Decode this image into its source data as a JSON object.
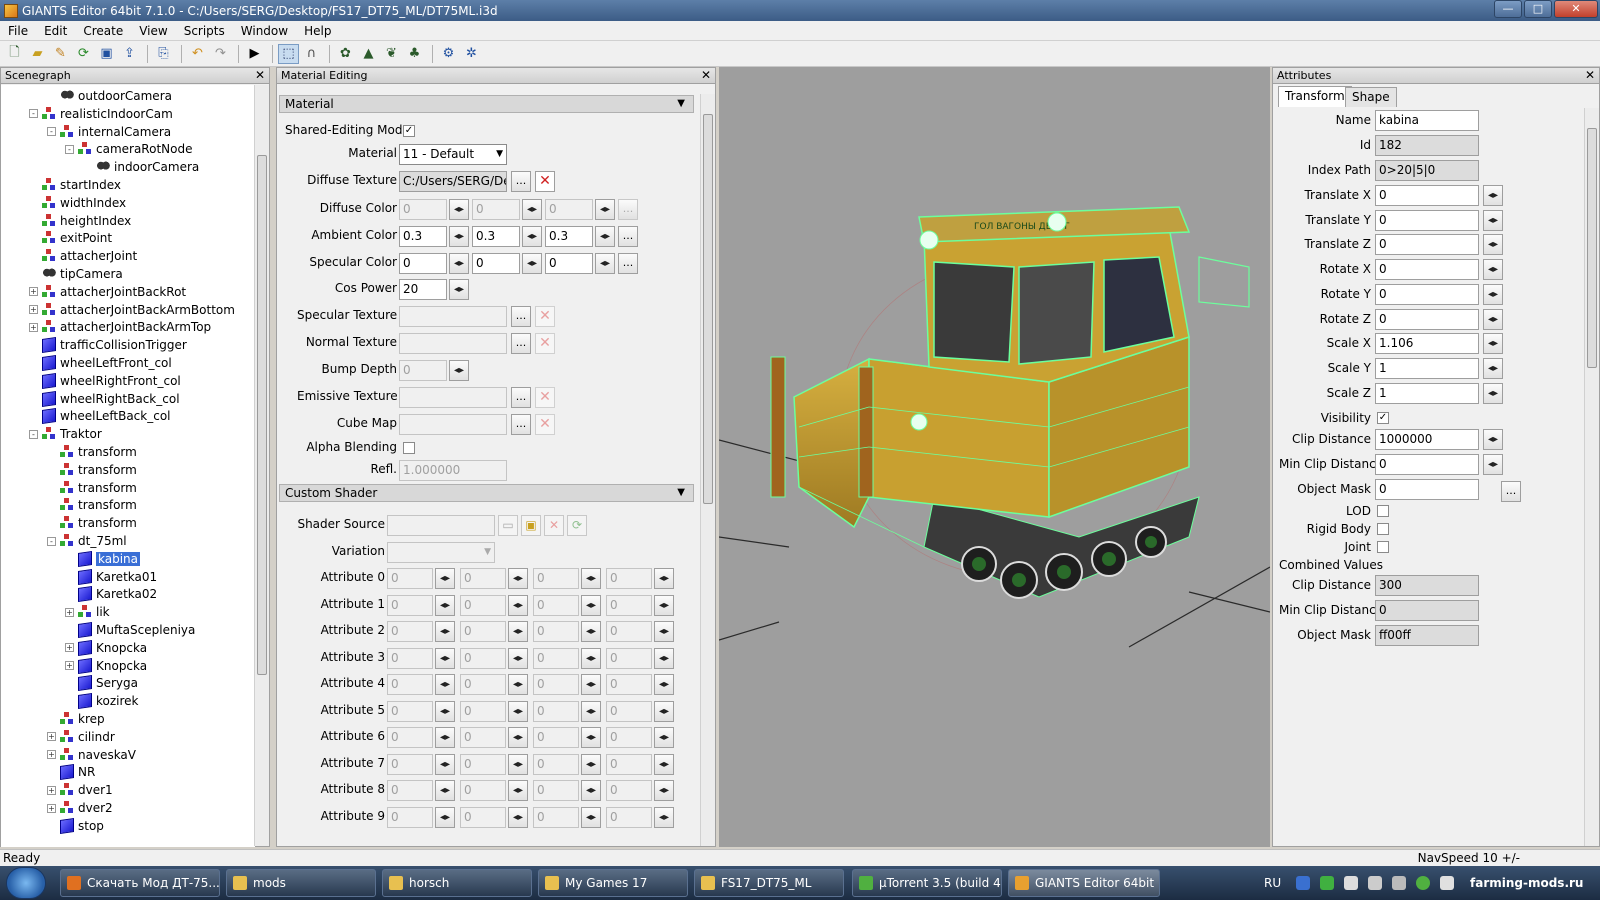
{
  "window": {
    "title": "GIANTS Editor 64bit 7.1.0 - C:/Users/SERG/Desktop/FS17_DT75_ML/DT75ML.i3d",
    "minimize": "—",
    "maximize": "□",
    "close": "✕"
  },
  "menu": [
    "File",
    "Edit",
    "Create",
    "View",
    "Scripts",
    "Window",
    "Help"
  ],
  "toolbar_icons": [
    "new-icon",
    "open-icon",
    "edit-icon",
    "refresh-icon",
    "save-icon",
    "export-icon",
    "import-icon",
    "undo-icon",
    "redo-icon",
    "play-icon",
    "select-icon",
    "magnet-icon",
    "paint-icon",
    "terrain-icon",
    "foliage-icon",
    "tree-icon",
    "sync-icon",
    "settings-icon"
  ],
  "scenegraph": {
    "title": "Scenegraph",
    "close": "✕",
    "items": [
      {
        "label": "outdoorCamera",
        "depth": 2,
        "icon": "camera",
        "exp": ""
      },
      {
        "label": "realisticIndoorCam",
        "depth": 1,
        "icon": "tg",
        "exp": "-"
      },
      {
        "label": "internalCamera",
        "depth": 2,
        "icon": "tg",
        "exp": "-"
      },
      {
        "label": "cameraRotNode",
        "depth": 3,
        "icon": "tg",
        "exp": "-"
      },
      {
        "label": "indoorCamera",
        "depth": 4,
        "icon": "camera",
        "exp": ""
      },
      {
        "label": "startIndex",
        "depth": 1,
        "icon": "tg",
        "exp": ""
      },
      {
        "label": "widthIndex",
        "depth": 1,
        "icon": "tg",
        "exp": ""
      },
      {
        "label": "heightIndex",
        "depth": 1,
        "icon": "tg",
        "exp": ""
      },
      {
        "label": "exitPoint",
        "depth": 1,
        "icon": "tg",
        "exp": ""
      },
      {
        "label": "attacherJoint",
        "depth": 1,
        "icon": "tg",
        "exp": ""
      },
      {
        "label": "tipCamera",
        "depth": 1,
        "icon": "camera",
        "exp": ""
      },
      {
        "label": "attacherJointBackRot",
        "depth": 1,
        "icon": "tg",
        "exp": "+"
      },
      {
        "label": "attacherJointBackArmBottom",
        "depth": 1,
        "icon": "tg",
        "exp": "+"
      },
      {
        "label": "attacherJointBackArmTop",
        "depth": 1,
        "icon": "tg",
        "exp": "+"
      },
      {
        "label": "trafficCollisionTrigger",
        "depth": 1,
        "icon": "cube",
        "exp": ""
      },
      {
        "label": "wheelLeftFront_col",
        "depth": 1,
        "icon": "cube",
        "exp": ""
      },
      {
        "label": "wheelRightFront_col",
        "depth": 1,
        "icon": "cube",
        "exp": ""
      },
      {
        "label": "wheelRightBack_col",
        "depth": 1,
        "icon": "cube",
        "exp": ""
      },
      {
        "label": "wheelLeftBack_col",
        "depth": 1,
        "icon": "cube",
        "exp": ""
      },
      {
        "label": "Traktor",
        "depth": 1,
        "icon": "tg",
        "exp": "-"
      },
      {
        "label": "transform",
        "depth": 2,
        "icon": "tg",
        "exp": ""
      },
      {
        "label": "transform",
        "depth": 2,
        "icon": "tg",
        "exp": ""
      },
      {
        "label": "transform",
        "depth": 2,
        "icon": "tg",
        "exp": ""
      },
      {
        "label": "transform",
        "depth": 2,
        "icon": "tg",
        "exp": ""
      },
      {
        "label": "transform",
        "depth": 2,
        "icon": "tg",
        "exp": ""
      },
      {
        "label": "dt_75ml",
        "depth": 2,
        "icon": "tg",
        "exp": "-"
      },
      {
        "label": "kabina",
        "depth": 3,
        "icon": "cube",
        "exp": "",
        "selected": true
      },
      {
        "label": "Karetka01",
        "depth": 3,
        "icon": "cube",
        "exp": ""
      },
      {
        "label": "Karetka02",
        "depth": 3,
        "icon": "cube",
        "exp": ""
      },
      {
        "label": "lik",
        "depth": 3,
        "icon": "tg",
        "exp": "+"
      },
      {
        "label": "MuftaScepleniya",
        "depth": 3,
        "icon": "cube",
        "exp": ""
      },
      {
        "label": "Knopcka",
        "depth": 3,
        "icon": "cube",
        "exp": "+"
      },
      {
        "label": "Knopcka",
        "depth": 3,
        "icon": "cube",
        "exp": "+"
      },
      {
        "label": "Seryga",
        "depth": 3,
        "icon": "cube",
        "exp": ""
      },
      {
        "label": "kozirek",
        "depth": 3,
        "icon": "cube",
        "exp": ""
      },
      {
        "label": "krep",
        "depth": 2,
        "icon": "tg",
        "exp": ""
      },
      {
        "label": "cilindr",
        "depth": 2,
        "icon": "tg",
        "exp": "+"
      },
      {
        "label": "naveskaV",
        "depth": 2,
        "icon": "tg",
        "exp": "+"
      },
      {
        "label": "NR",
        "depth": 2,
        "icon": "cube",
        "exp": ""
      },
      {
        "label": "dver1",
        "depth": 2,
        "icon": "tg",
        "exp": "+"
      },
      {
        "label": "dver2",
        "depth": 2,
        "icon": "tg",
        "exp": "+"
      },
      {
        "label": "stop",
        "depth": 2,
        "icon": "cube",
        "exp": ""
      }
    ]
  },
  "material": {
    "panel_title": "Material Editing",
    "close": "✕",
    "section_material": "Material",
    "shared_mode_label": "Shared-Editing Mode",
    "shared_mode_checked": "✓",
    "material_label": "Material",
    "material_value": "11 - Default",
    "diffuse_texture_label": "Diffuse Texture",
    "diffuse_texture_value": "C:/Users/SERG/Des",
    "dots": "...",
    "redx": "✕",
    "spin": "◂▸",
    "diffuse_color_label": "Diffuse Color",
    "diffuse_color": [
      "0",
      "0",
      "0"
    ],
    "ambient_color_label": "Ambient Color",
    "ambient_color": [
      "0.3",
      "0.3",
      "0.3"
    ],
    "specular_color_label": "Specular Color",
    "specular_color": [
      "0",
      "0",
      "0"
    ],
    "cos_power_label": "Cos Power",
    "cos_power": "20",
    "specular_texture_label": "Specular Texture",
    "normal_texture_label": "Normal Texture",
    "bump_depth_label": "Bump Depth",
    "bump_depth": "0",
    "emissive_texture_label": "Emissive Texture",
    "cube_map_label": "Cube Map",
    "alpha_blending_label": "Alpha Blending",
    "refl_label": "Refl.",
    "refl_value": "1.000000",
    "section_shader": "Custom Shader",
    "shader_source_label": "Shader Source",
    "variation_label": "Variation",
    "attributes": [
      {
        "label": "Attribute 0",
        "values": [
          "0",
          "0",
          "0",
          "0"
        ]
      },
      {
        "label": "Attribute 1",
        "values": [
          "0",
          "0",
          "0",
          "0"
        ]
      },
      {
        "label": "Attribute 2",
        "values": [
          "0",
          "0",
          "0",
          "0"
        ]
      },
      {
        "label": "Attribute 3",
        "values": [
          "0",
          "0",
          "0",
          "0"
        ]
      },
      {
        "label": "Attribute 4",
        "values": [
          "0",
          "0",
          "0",
          "0"
        ]
      },
      {
        "label": "Attribute 5",
        "values": [
          "0",
          "0",
          "0",
          "0"
        ]
      },
      {
        "label": "Attribute 6",
        "values": [
          "0",
          "0",
          "0",
          "0"
        ]
      },
      {
        "label": "Attribute 7",
        "values": [
          "0",
          "0",
          "0",
          "0"
        ]
      },
      {
        "label": "Attribute 8",
        "values": [
          "0",
          "0",
          "0",
          "0"
        ]
      },
      {
        "label": "Attribute 9",
        "values": [
          "0",
          "0",
          "0",
          "0"
        ]
      }
    ]
  },
  "viewport": {
    "model_label": "ГОЛ ВАГОНЫ ДЕНЬГ"
  },
  "attributes": {
    "title": "Attributes",
    "close": "✕",
    "tab_transform": "Transform",
    "tab_shape": "Shape",
    "name_label": "Name",
    "name": "kabina",
    "id_label": "Id",
    "id": "182",
    "index_path_label": "Index Path",
    "index_path": "0>20|5|0",
    "rows": [
      {
        "label": "Translate X",
        "value": "0"
      },
      {
        "label": "Translate Y",
        "value": "0"
      },
      {
        "label": "Translate Z",
        "value": "0"
      },
      {
        "label": "Rotate X",
        "value": "0"
      },
      {
        "label": "Rotate Y",
        "value": "0"
      },
      {
        "label": "Rotate Z",
        "value": "0"
      },
      {
        "label": "Scale X",
        "value": "1.106"
      },
      {
        "label": "Scale Y",
        "value": "1"
      },
      {
        "label": "Scale Z",
        "value": "1"
      }
    ],
    "visibility_label": "Visibility",
    "visibility_checked": "✓",
    "clip_distance_label": "Clip Distance",
    "clip_distance": "1000000",
    "min_clip_label": "Min Clip Distance",
    "min_clip": "0",
    "object_mask_label": "Object Mask",
    "object_mask": "0",
    "lod_label": "LOD",
    "rigid_label": "Rigid Body",
    "joint_label": "Joint",
    "combined_label": "Combined Values",
    "c_clip_label": "Clip Distance",
    "c_clip": "300",
    "c_min_label": "Min Clip Distance",
    "c_min": "0",
    "c_mask_label": "Object Mask",
    "c_mask": "ff00ff",
    "dots": "..."
  },
  "status": {
    "left": "Ready",
    "right": "NavSpeed 10 +/-"
  },
  "taskbar": {
    "tasks": [
      {
        "label": "Скачать Мод ДТ-75...",
        "color": "#e07020"
      },
      {
        "label": "mods",
        "color": "#e8c050"
      },
      {
        "label": "horsch",
        "color": "#e8c050"
      },
      {
        "label": "My Games 17",
        "color": "#e8c050"
      },
      {
        "label": "FS17_DT75_ML",
        "color": "#e8c050"
      },
      {
        "label": "µTorrent 3.5  (build 4...",
        "color": "#50b040"
      },
      {
        "label": "GIANTS Editor 64bit ...",
        "color": "#e8a030",
        "active": true
      }
    ],
    "lang": "RU",
    "watermark": "farming-mods.ru"
  },
  "colors": {
    "selection": "#3a6fd6",
    "wireframe": "#6cff9c",
    "tractor_body": "#c8a030",
    "viewport_bg": "#9e9e9e"
  }
}
